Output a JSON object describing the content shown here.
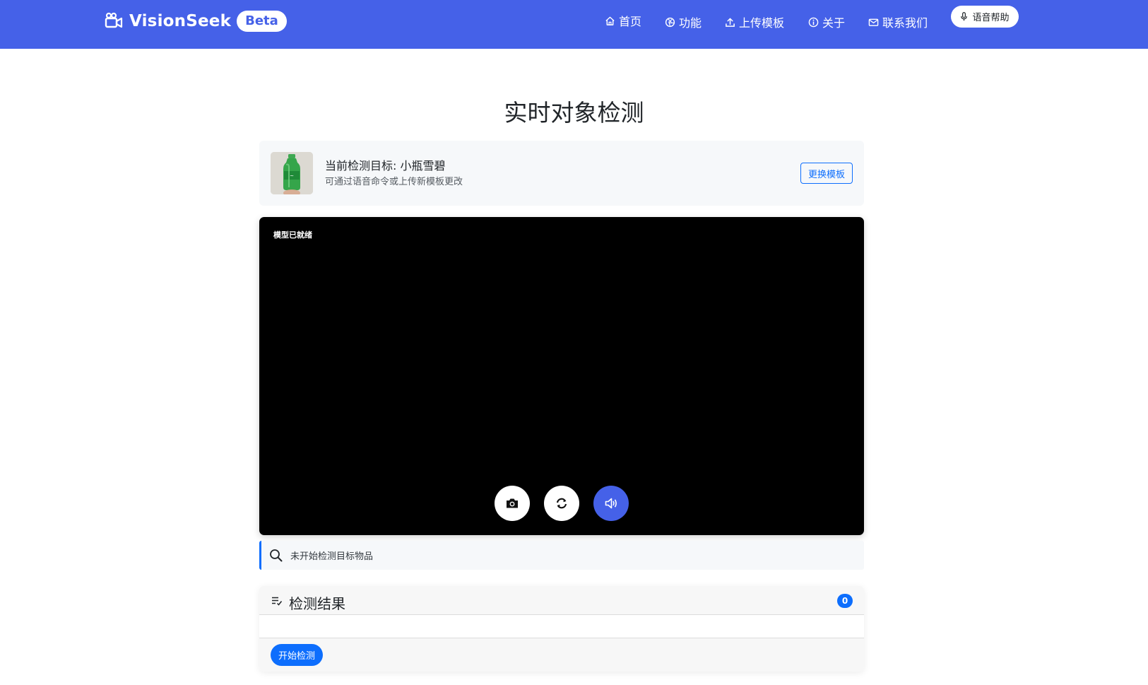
{
  "navbar": {
    "brand_name": "VisionSeek",
    "badge": "Beta",
    "links": [
      {
        "label": "首页",
        "icon": "home-icon"
      },
      {
        "label": "功能",
        "icon": "aperture-icon"
      },
      {
        "label": "上传模板",
        "icon": "upload-icon"
      },
      {
        "label": "关于",
        "icon": "info-icon"
      },
      {
        "label": "联系我们",
        "icon": "envelope-icon"
      }
    ],
    "voice_help": "语音帮助"
  },
  "page_title": "实时对象检测",
  "target": {
    "title": "当前检测目标: 小瓶雪碧",
    "subtitle": "可通过语音命令或上传新模板更改",
    "change_button": "更换模板"
  },
  "video": {
    "status": "模型已就绪",
    "controls": [
      "camera-icon",
      "switch-camera-icon",
      "volume-icon"
    ]
  },
  "detection_status": "未开始检测目标物品",
  "results": {
    "title": "检测结果",
    "count": "0",
    "start_button": "开始检测"
  },
  "colors": {
    "navbar": "#4561e8",
    "primary": "#0d6efd",
    "video_bg": "#000000"
  }
}
